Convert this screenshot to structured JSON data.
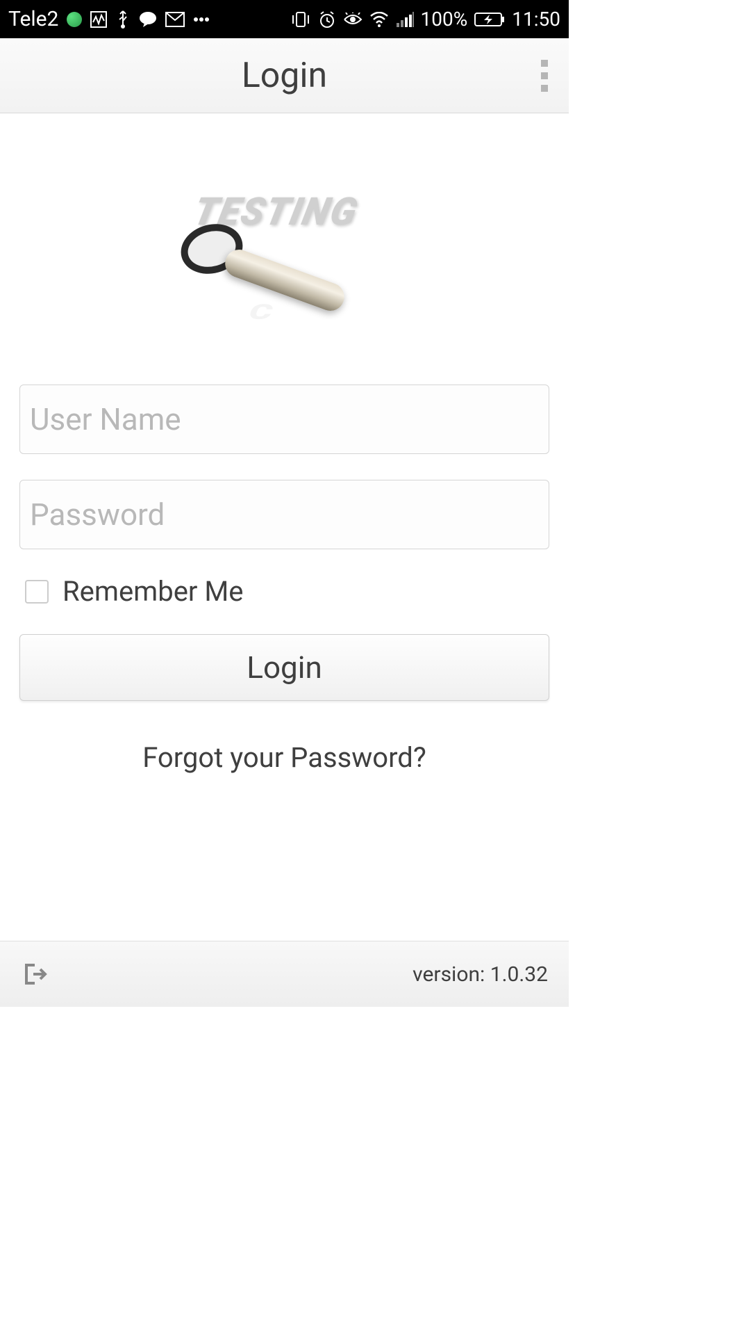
{
  "statusBar": {
    "carrier": "Tele2",
    "batteryText": "100%",
    "time": "11:50"
  },
  "appBar": {
    "title": "Login"
  },
  "logo": {
    "text": "TESTING",
    "reflection": "C"
  },
  "form": {
    "usernamePlaceholder": "User Name",
    "passwordPlaceholder": "Password",
    "rememberLabel": "Remember Me",
    "loginButton": "Login",
    "forgotLink": "Forgot your Password?"
  },
  "footer": {
    "version": "version: 1.0.32"
  }
}
